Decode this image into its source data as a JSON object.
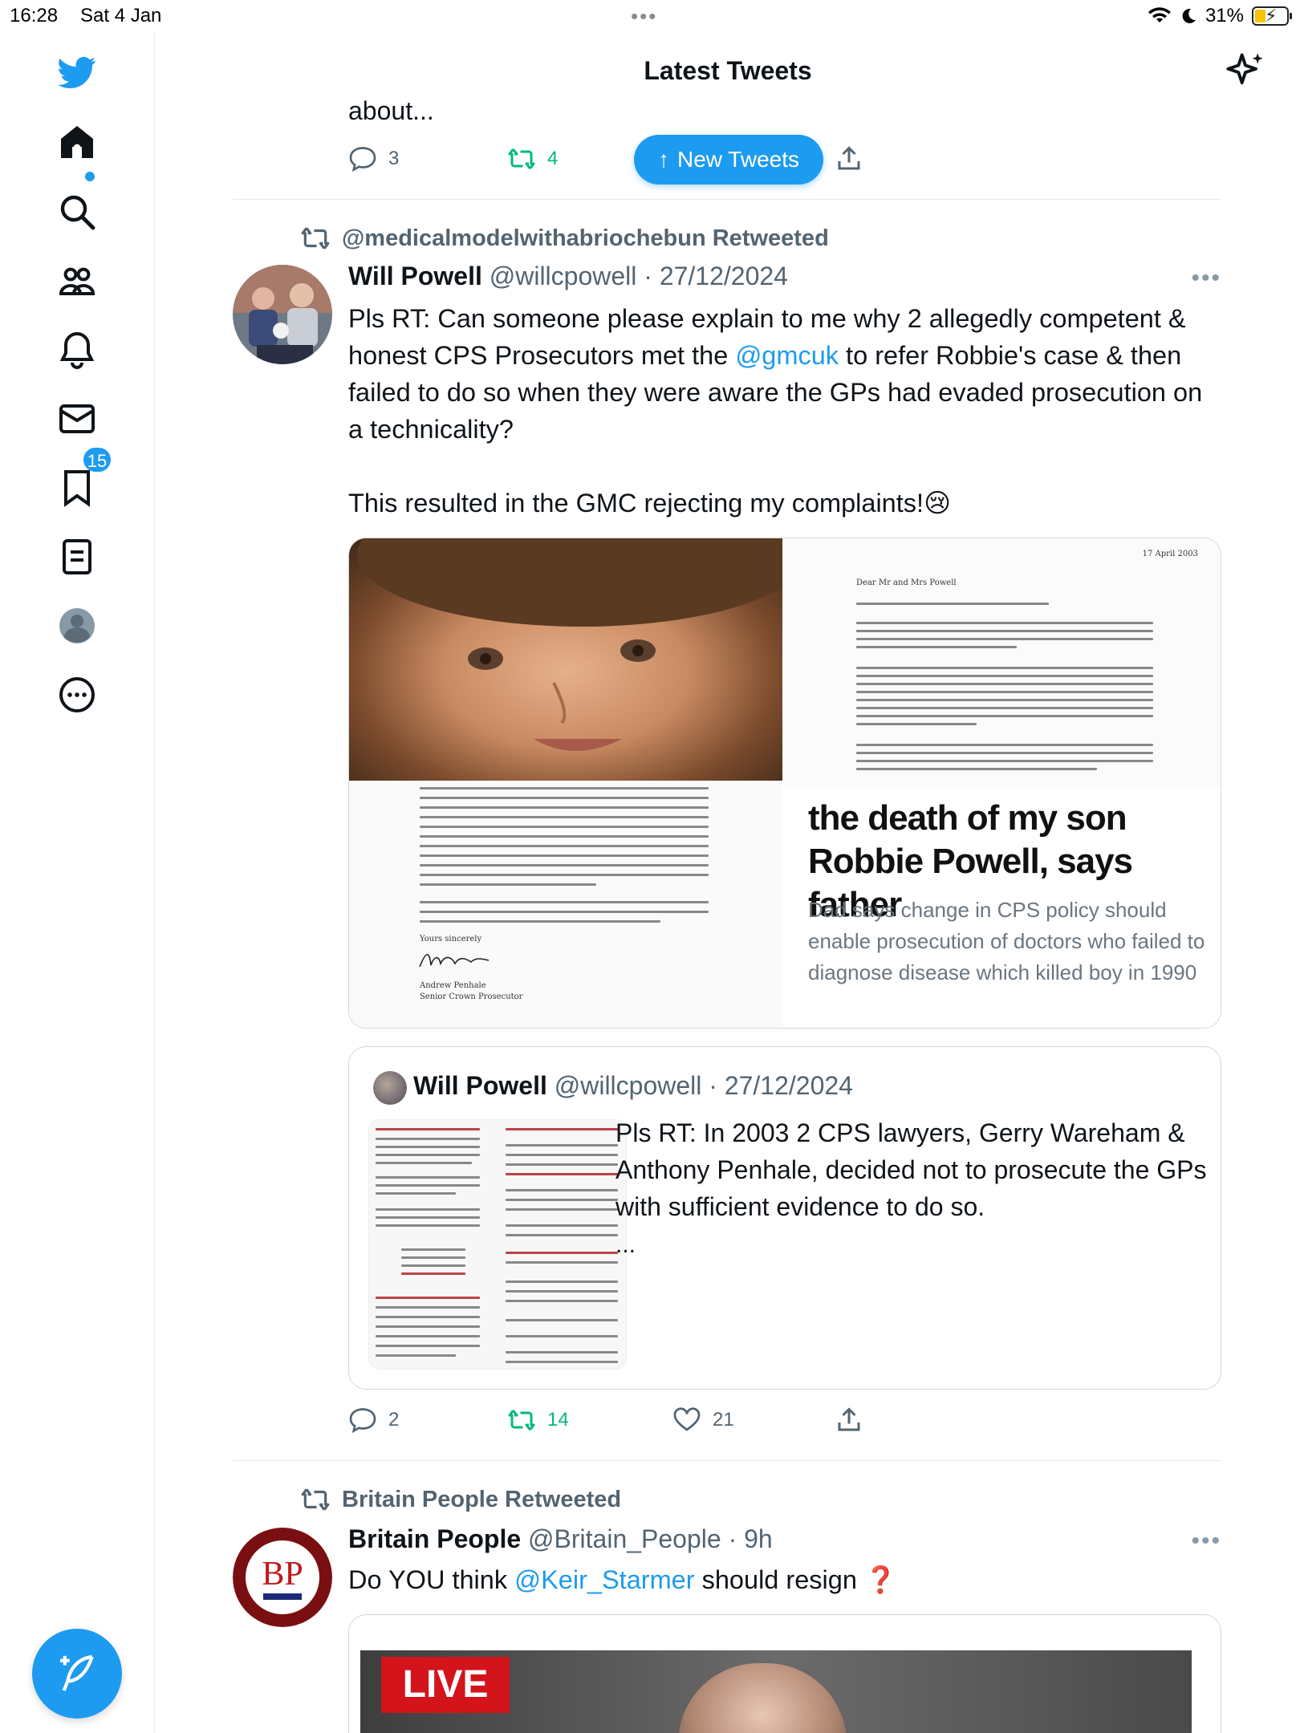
{
  "status_bar": {
    "time": "16:28",
    "date": "Sat 4 Jan",
    "battery": "31%"
  },
  "header": {
    "title": "Latest Tweets"
  },
  "sidebar": {
    "notification_count": "15"
  },
  "prev_tweet": {
    "text_fragment": "about...",
    "reply_count": "3",
    "retweet_count": "4",
    "new_tweets_label": "New Tweets"
  },
  "tweet1": {
    "retweeted_by": "@medicalmodelwithabriochebun Retweeted",
    "name": "Will Powell",
    "meta": "@willcpowell · 27/12/2024",
    "text_a": "Pls RT: Can someone please explain to me why 2 allegedly competent & honest CPS Prosecutors met the ",
    "mention": "@gmcuk",
    "text_b": " to refer Robbie's case & then failed to do so when they were aware the GPs had evaded prosecution on a technicality?",
    "text_c": "This resulted in the GMC rejecting my complaints!",
    "emoji": "😢",
    "media": {
      "letter_date": "17 April 2003",
      "letter_salutation": "Dear Mr and Mrs Powell",
      "letter_signoff": "Yours sincerely",
      "letter_signatory": "Andrew Penhale",
      "letter_role": "Senior Crown Prosecutor",
      "headline": "the death of my son Robbie Powell, says father",
      "dek": "Dad says change in CPS policy should enable prosecution of doctors who failed to diagnose disease which killed boy in 1990"
    },
    "quote": {
      "name": "Will Powell",
      "meta": "@willcpowell · 27/12/2024",
      "text": "Pls RT: In 2003 2 CPS lawyers, Gerry Wareham & Anthony Penhale, decided not to prosecute the GPs with sufficient evidence to do so.",
      "ellipsis": "..."
    },
    "reply_count": "2",
    "retweet_count": "14",
    "like_count": "21"
  },
  "tweet2": {
    "retweeted_by": "Britain People Retweeted",
    "name": "Britain People",
    "meta": "@Britain_People · 9h",
    "text_a": "Do YOU think ",
    "mention": "@Keir_Starmer",
    "text_b": " should resign ",
    "emoji": "❓",
    "avatar_text": "BP",
    "media_badge": "LIVE"
  },
  "colors": {
    "accent": "#1d9bf0",
    "retweet_green": "#00ba7c",
    "secondary": "#536471"
  }
}
